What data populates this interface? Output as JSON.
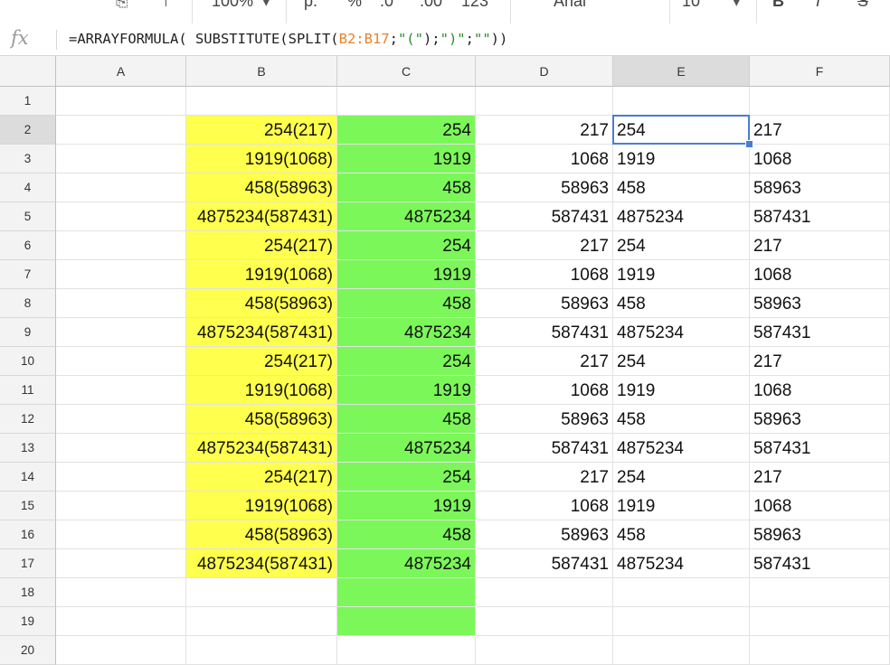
{
  "toolbar": {
    "zoom": "100%",
    "format_currency": "p.",
    "format_percent": "%",
    "format_decimal_dec": ".0",
    "format_decimal_inc": ".00",
    "format_more": "123",
    "font_name": "Arial",
    "font_size": "10",
    "bold": "B",
    "italic": "I",
    "strike": "S"
  },
  "formula_bar": {
    "fx": "fx",
    "prefix": "=ARRAYFORMULA( SUBSTITUTE(SPLIT(",
    "range": "B2:B17",
    "sep1": ";",
    "str1": "\"(\"",
    "mid": ");",
    "str2": "\")\"",
    "sep2": ";",
    "str3": "\"\"",
    "suffix": "))"
  },
  "columns": [
    "A",
    "B",
    "C",
    "D",
    "E",
    "F"
  ],
  "rows": [
    "1",
    "2",
    "3",
    "4",
    "5",
    "6",
    "7",
    "8",
    "9",
    "10",
    "11",
    "12",
    "13",
    "14",
    "15",
    "16",
    "17",
    "18",
    "19",
    "20"
  ],
  "active_cell": "E2",
  "colors": {
    "highlight_yellow": "#ffff4d",
    "highlight_green": "#7cf75a",
    "selection": "#4a7bd8"
  },
  "cells": {
    "B": [
      "",
      "254(217)",
      "1919(1068)",
      "458(58963)",
      "4875234(587431)",
      "254(217)",
      "1919(1068)",
      "458(58963)",
      "4875234(587431)",
      "254(217)",
      "1919(1068)",
      "458(58963)",
      "4875234(587431)",
      "254(217)",
      "1919(1068)",
      "458(58963)",
      "4875234(587431)",
      "",
      "",
      ""
    ],
    "C": [
      "",
      "254",
      "1919",
      "458",
      "4875234",
      "254",
      "1919",
      "458",
      "4875234",
      "254",
      "1919",
      "458",
      "4875234",
      "254",
      "1919",
      "458",
      "4875234",
      "",
      "",
      ""
    ],
    "D": [
      "",
      "217",
      "1068",
      "58963",
      "587431",
      "217",
      "1068",
      "58963",
      "587431",
      "217",
      "1068",
      "58963",
      "587431",
      "217",
      "1068",
      "58963",
      "587431",
      "",
      "",
      ""
    ],
    "E": [
      "",
      "254",
      "1919",
      "458",
      "4875234",
      "254",
      "1919",
      "458",
      "4875234",
      "254",
      "1919",
      "458",
      "4875234",
      "254",
      "1919",
      "458",
      "4875234",
      "",
      "",
      ""
    ],
    "F": [
      "",
      "217",
      "1068",
      "58963",
      "587431",
      "217",
      "1068",
      "58963",
      "587431",
      "217",
      "1068",
      "58963",
      "587431",
      "217",
      "1068",
      "58963",
      "587431",
      "",
      "",
      ""
    ]
  }
}
